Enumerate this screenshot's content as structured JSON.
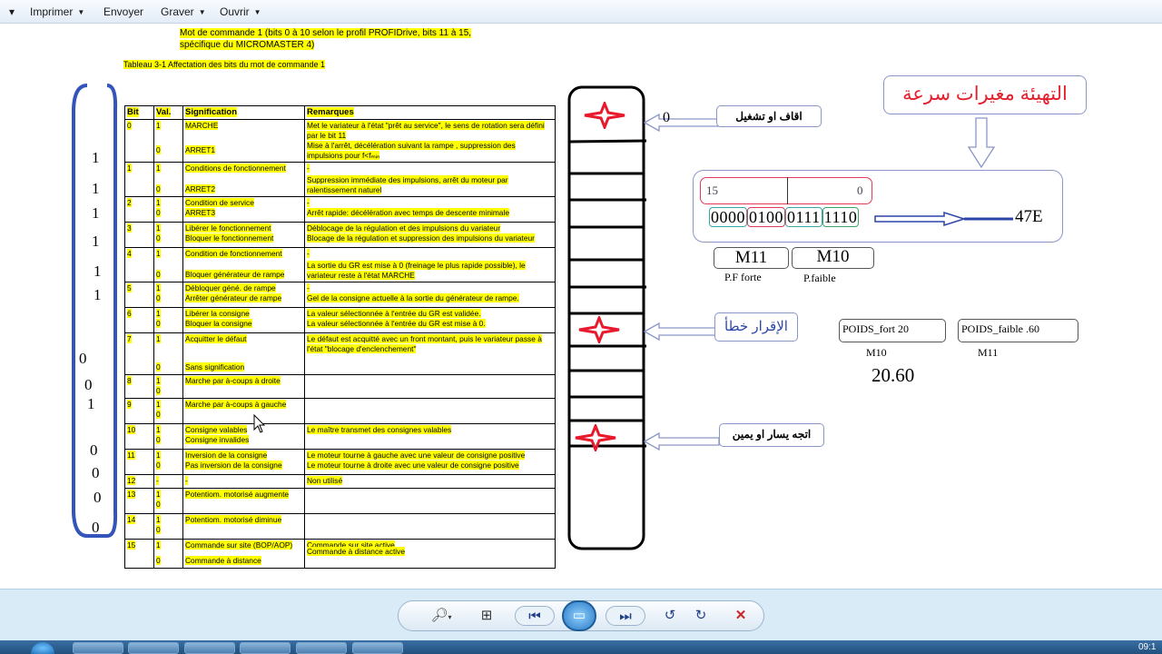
{
  "menu": {
    "first_arrow": "▾",
    "items": [
      {
        "label": "Imprimer"
      },
      {
        "label": "Envoyer"
      },
      {
        "label": "Graver"
      },
      {
        "label": "Ouvrir"
      }
    ]
  },
  "doc": {
    "heading_line1": "Mot de commande 1 (bits 0 à 10 selon le profil PROFIDrive, bits 11 à 15,",
    "heading_line2": "spécifique du MICROMASTER 4)",
    "table_caption": "Tableau 3-1   Affectation des bits du mot de commande 1",
    "table_headers": [
      "Bit",
      "Val.",
      "Signification",
      "Remarques"
    ],
    "rows": [
      {
        "bit": "0",
        "vals": [
          "1",
          "0"
        ],
        "sig": [
          "MARCHE",
          "ARRET1"
        ],
        "rem": [
          "Met le variateur à l'état \"prêt au service\", le sens de rotation sera défini par le bit 11",
          "Mise à l'arrêt, décélération suivant la rampe , suppression des impulsions pour f<fₘᵢₙ"
        ]
      },
      {
        "bit": "1",
        "vals": [
          "1",
          "0"
        ],
        "sig": [
          "Conditions de fonctionnement",
          "ARRET2"
        ],
        "rem": [
          "-",
          "Suppression immédiate des impulsions, arrêt du moteur par ralentissement naturel"
        ]
      },
      {
        "bit": "2",
        "vals": [
          "1",
          "0"
        ],
        "sig": [
          "Condition de service",
          "ARRET3"
        ],
        "rem": [
          "-",
          "Arrêt rapide: décélération avec temps de descente minimale"
        ]
      },
      {
        "bit": "3",
        "vals": [
          "1",
          "0"
        ],
        "sig": [
          "Libérer le fonctionnement",
          "Bloquer le fonctionnement"
        ],
        "rem": [
          "Déblocage de la régulation et des impulsions du variateur",
          "Blocage de la régulation et suppression des impulsions du variateur"
        ]
      },
      {
        "bit": "4",
        "vals": [
          "1",
          "0"
        ],
        "sig": [
          "Condition de fonctionnement",
          "Bloquer générateur de rampe"
        ],
        "rem": [
          "-",
          "La sortie du GR est mise à  0 (freinage le plus rapide possible), le variateur reste à l'état MARCHE"
        ]
      },
      {
        "bit": "5",
        "vals": [
          "1",
          "0"
        ],
        "sig": [
          "Débloquer géné. de rampe",
          "Arrêter générateur de rampe"
        ],
        "rem": [
          "-",
          "Gel de la consigne actuelle à la sortie du générateur de rampe."
        ]
      },
      {
        "bit": "6",
        "vals": [
          "1",
          "0"
        ],
        "sig": [
          "Libérer la consigne",
          "Bloquer la consigne"
        ],
        "rem": [
          "La valeur sélectionnée à l'entrée du GR est validée.",
          "La valeur sélectionnée à l'entrée du GR est mise à 0."
        ]
      },
      {
        "bit": "7",
        "vals": [
          "1",
          "0"
        ],
        "sig": [
          "Acquitter le défaut",
          "Sans signification"
        ],
        "rem": [
          "Le défaut est acquitté avec un front montant, puis le variateur passe à l'état \"blocage d'enclenchement\"",
          ""
        ]
      },
      {
        "bit": "8",
        "vals": [
          "1",
          "0"
        ],
        "sig": [
          "Marche par à-coups à droite",
          ""
        ],
        "rem": [
          "",
          ""
        ]
      },
      {
        "bit": "9",
        "vals": [
          "1",
          "0"
        ],
        "sig": [
          "Marche par à-coups à gauche",
          ""
        ],
        "rem": [
          "",
          ""
        ]
      },
      {
        "bit": "10",
        "vals": [
          "1",
          "0"
        ],
        "sig": [
          "Consigne valables",
          "Consigne invalides"
        ],
        "rem": [
          "Le maître transmet des consignes valables",
          ""
        ]
      },
      {
        "bit": "11",
        "vals": [
          "1",
          "0"
        ],
        "sig": [
          "Inversion de la consigne",
          "Pas inversion de la consigne"
        ],
        "rem": [
          "Le moteur tourne à gauche avec une valeur de consigne positive",
          "Le moteur tourne à droite avec une valeur de consigne positive"
        ]
      },
      {
        "bit": "12",
        "vals": [
          "-"
        ],
        "sig": [
          "-"
        ],
        "rem": [
          "Non utilisé"
        ]
      },
      {
        "bit": "13",
        "vals": [
          "1",
          "0"
        ],
        "sig": [
          "Potentiom. motorisé augmente",
          ""
        ],
        "rem": [
          "",
          ""
        ]
      },
      {
        "bit": "14",
        "vals": [
          "1",
          "0"
        ],
        "sig": [
          "Potentiom. motorisé diminue",
          ""
        ],
        "rem": [
          "",
          ""
        ]
      },
      {
        "bit": "15",
        "vals": [
          "1",
          "0"
        ],
        "sig": [
          "Commande sur site (BOP/AOP)",
          "Commande à distance"
        ],
        "rem": [
          "Commande sur site active",
          "Commande à distance active"
        ]
      }
    ],
    "bit_values": [
      "1",
      "1",
      "1",
      "1",
      "1",
      "1",
      "0",
      "0",
      "1",
      "0",
      "0",
      "0",
      "0"
    ],
    "label_run": "اقاف او تشغيل",
    "label_run_value": "0",
    "label_ack": "الإقرار خطأ",
    "label_dir": "اتجه يسار او يمين",
    "title_ar": "التهيئة مغيرات سرعة",
    "reg_high": "15",
    "reg_low": "0",
    "binary_groups": [
      "0000",
      "0100",
      "0111",
      "1110"
    ],
    "hex_value": "47E",
    "m11": "M11",
    "m10": "M10",
    "pf_forte": "P.F forte",
    "p_faible": "P.faible",
    "poids_fort": "POIDS_fort 20",
    "poids_faible": "POIDS_faible  .60",
    "m10_lbl": "M10",
    "m11_lbl": "M11",
    "result": "20.60"
  },
  "viewer": {
    "controls": [
      "zoom-icon",
      "fit-icon",
      "previous-icon",
      "slideshow-icon",
      "next-icon",
      "rotate-left-icon",
      "rotate-right-icon",
      "delete-icon"
    ]
  },
  "clock": "09:1",
  "colors": {
    "highlight": "#ffff00",
    "bracket": "#3355bb",
    "star": "#e8192c",
    "title_ar": "#e5202e"
  }
}
